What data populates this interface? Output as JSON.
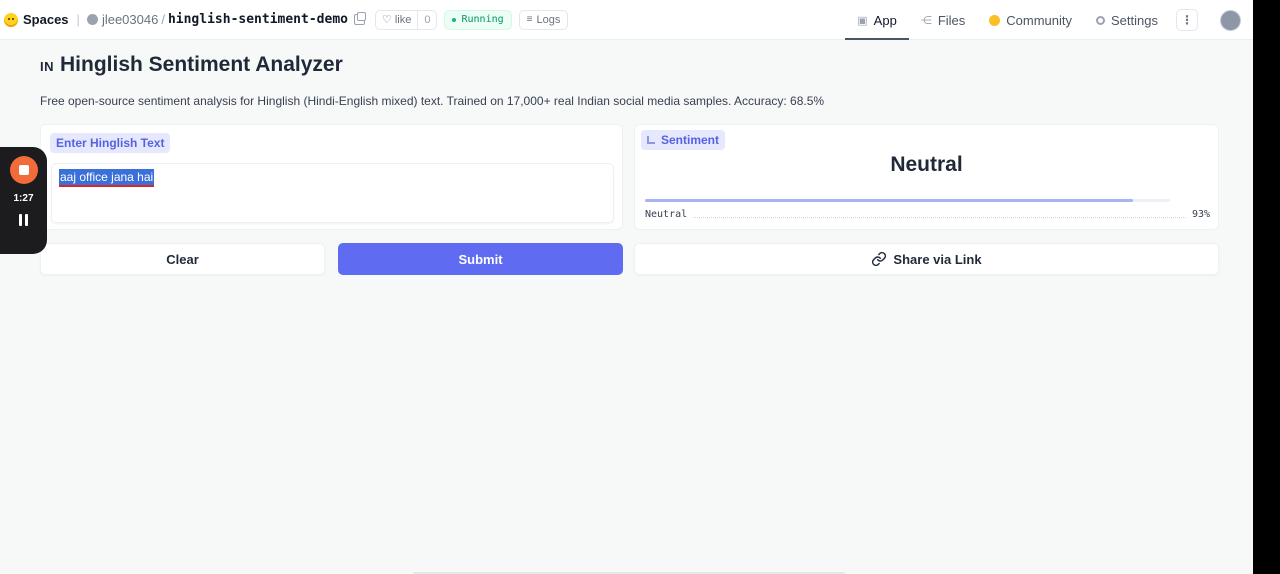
{
  "nav": {
    "spaces_label": "Spaces",
    "owner": "jlee03046",
    "separator": "/",
    "repo_name": "hinglish-sentiment-demo",
    "like_label": "like",
    "like_count": "0",
    "status": "Running",
    "logs_label": "Logs",
    "tabs": [
      {
        "label": "App",
        "icon": "cube-icon",
        "active": true
      },
      {
        "label": "Files",
        "icon": "files-icon",
        "active": false
      },
      {
        "label": "Community",
        "icon": "community-icon",
        "active": false
      },
      {
        "label": "Settings",
        "icon": "gear-icon",
        "active": false
      }
    ],
    "more_label": "⋮"
  },
  "app": {
    "flag": "IN",
    "title": "Hinglish Sentiment Analyzer",
    "description": "Free open-source sentiment analysis for Hinglish (Hindi-English mixed) text. Trained on 17,000+ real Indian social media samples. Accuracy: 68.5%"
  },
  "input": {
    "label": "Enter Hinglish Text",
    "value": "aaj office jana hai"
  },
  "output": {
    "label": "Sentiment",
    "result": "Neutral",
    "confidences": [
      {
        "label": "Neutral",
        "percent": "93%",
        "fraction": 0.93
      }
    ]
  },
  "buttons": {
    "clear": "Clear",
    "submit": "Submit",
    "share": "Share via Link"
  },
  "recorder": {
    "elapsed": "1:27"
  },
  "colors": {
    "primary": "#5f6bf0",
    "label_bg": "#e6e8fd",
    "label_text": "#5563e0",
    "running": "#059669",
    "recorder_stop": "#f26b3a"
  }
}
